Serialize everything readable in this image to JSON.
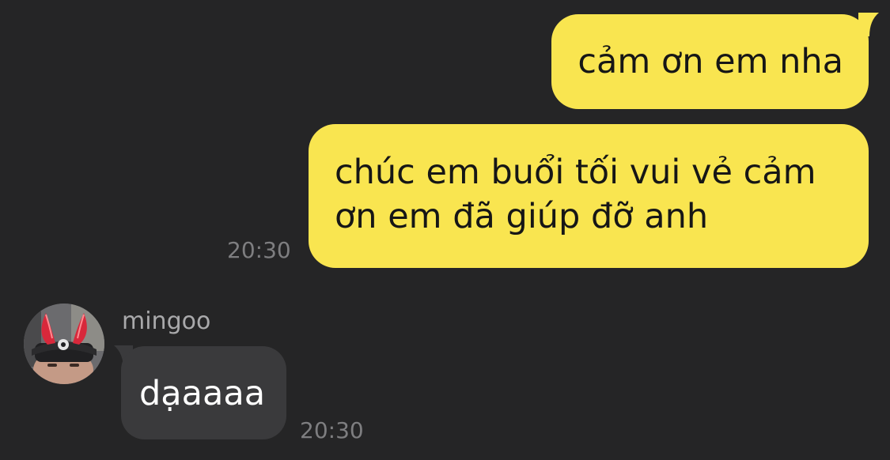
{
  "conversation": {
    "outgoing": [
      {
        "text": "cảm ơn em nha"
      },
      {
        "text": "chúc em buổi tối vui vẻ cảm ơn em đã giúp đỡ anh",
        "time": "20:30"
      }
    ],
    "incoming": [
      {
        "sender": "mingoo",
        "text": "dạaaaa",
        "time": "20:30"
      }
    ]
  },
  "colors": {
    "background": "#252526",
    "outgoing_bubble": "#f9e550",
    "incoming_bubble": "#3a3a3c",
    "timestamp": "#7e7e80",
    "sender_name": "#a9a9ab"
  },
  "icons": {
    "avatar": "avatar-devil-horns"
  }
}
